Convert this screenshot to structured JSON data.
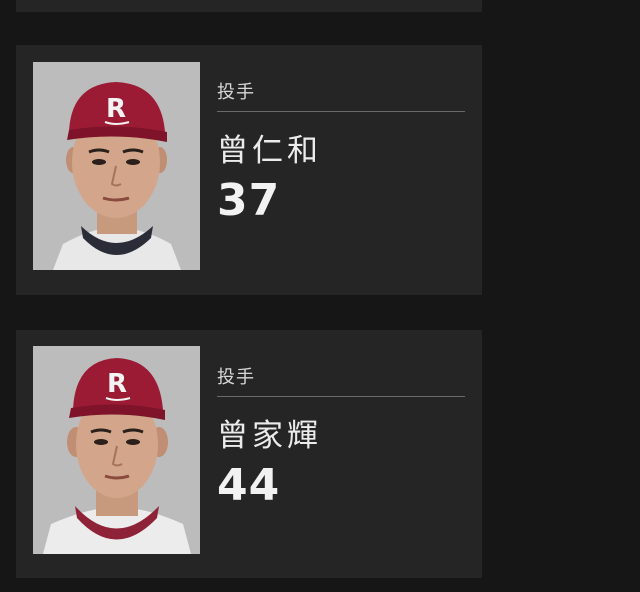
{
  "players": [
    {
      "position": "投手",
      "name": "曾仁和",
      "number": "37",
      "photo_icon": "player-portrait",
      "cap_letter": "R"
    },
    {
      "position": "投手",
      "name": "曾家輝",
      "number": "44",
      "photo_icon": "player-portrait",
      "cap_letter": "R"
    }
  ],
  "colors": {
    "background": "#161616",
    "card": "#252525",
    "cap": "#9b1b35",
    "photo_bg": "#b9b9b9"
  }
}
